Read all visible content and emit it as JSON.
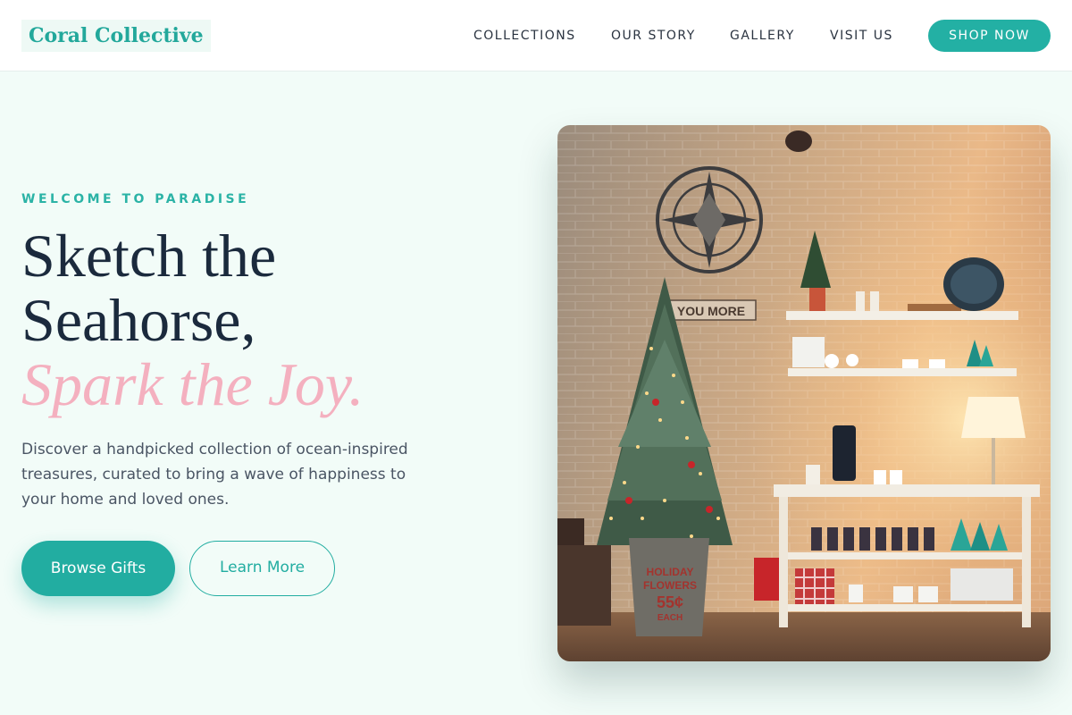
{
  "header": {
    "logo": "Coral Collective",
    "nav": [
      "COLLECTIONS",
      "OUR STORY",
      "GALLERY",
      "VISIT US"
    ],
    "cta": "SHOP NOW"
  },
  "hero": {
    "eyebrow": "WELCOME TO PARADISE",
    "title_line1": "Sketch the",
    "title_line2": "Seahorse,",
    "title_accent": "Spark the Joy.",
    "description": "Discover a handpicked collection of ocean-inspired treasures, curated to bring a wave of happiness to your home and loved ones.",
    "primary_button": "Browse Gifts",
    "secondary_button": "Learn More"
  },
  "image": {
    "sign_text": "YOU MORE",
    "bucket_text_1": "HOLIDAY",
    "bucket_text_2": "FLOWERS",
    "bucket_price": "55¢",
    "bucket_each": "EACH"
  },
  "colors": {
    "accent": "#23b0a4",
    "pink": "#f4b0bf",
    "navy": "#1b2a3d",
    "background": "#f2fcf8"
  }
}
